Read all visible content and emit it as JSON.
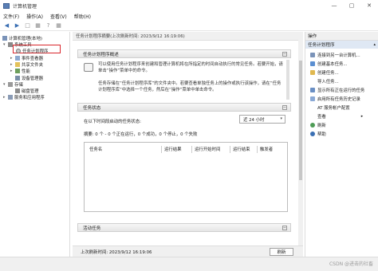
{
  "window": {
    "title": "计算机管理"
  },
  "menu": [
    "文件(F)",
    "操作(A)",
    "查看(V)",
    "帮助(H)"
  ],
  "tree": {
    "root": "计算机管理(本地)",
    "system_tools": "系统工具",
    "task_scheduler": "任务计划程序",
    "event_viewer": "事件查看器",
    "shared_folders": "共享文件夹",
    "performance": "性能",
    "device_manager": "设备管理器",
    "storage": "存储",
    "disk_management": "磁盘管理",
    "services_apps": "服务和应用程序"
  },
  "center": {
    "header": "任务计划程序摘要(上次刷新时间: 2023/9/12 16:19:06)",
    "overview_title": "任务计划程序概述",
    "overview_p1": "可以使用任务计划程序来创建和管理计算机将在所指定的时间自动执行的常见任务。若要开始，请单击“操作”菜单中的命令。",
    "overview_p2": "任务存储在“任务计划程序库”的文件夹中。若要查看单独任务上的操作或执行该操作，请在“任务计划程序库”中选择一个任务，然后在“操作”菜单中单击命令。",
    "status_title": "任务状态",
    "status_label": "在以下时间段启动的任务状态:",
    "period": "近 24 小时",
    "summary": "摘要: 0 个 - 0 个正在运行，0 个成功，0 个停止，0 个失败",
    "columns": [
      "任务名",
      "运行结果",
      "运行开始时间",
      "运行结束",
      "触发者"
    ],
    "active_title": "活动任务",
    "footer_text": "上次刷新时间: 2023/9/12 16:19:06",
    "refresh_label": "刷新"
  },
  "actions": {
    "title": "操作",
    "subtitle": "任务计划程序",
    "items": [
      "连接到另一台计算机...",
      "创建基本任务...",
      "创建任务...",
      "导入任务...",
      "显示所有正在运行的任务",
      "启用所有任务历史记录",
      "AT 服务帐户配置",
      "查看",
      "刷新",
      "帮助"
    ]
  },
  "watermark": "CSDN @进击的社畜",
  "colors": {
    "accent": "#3a6fb3",
    "selection_outline": "#d9262c",
    "actions_header": "#dfe8f4"
  }
}
